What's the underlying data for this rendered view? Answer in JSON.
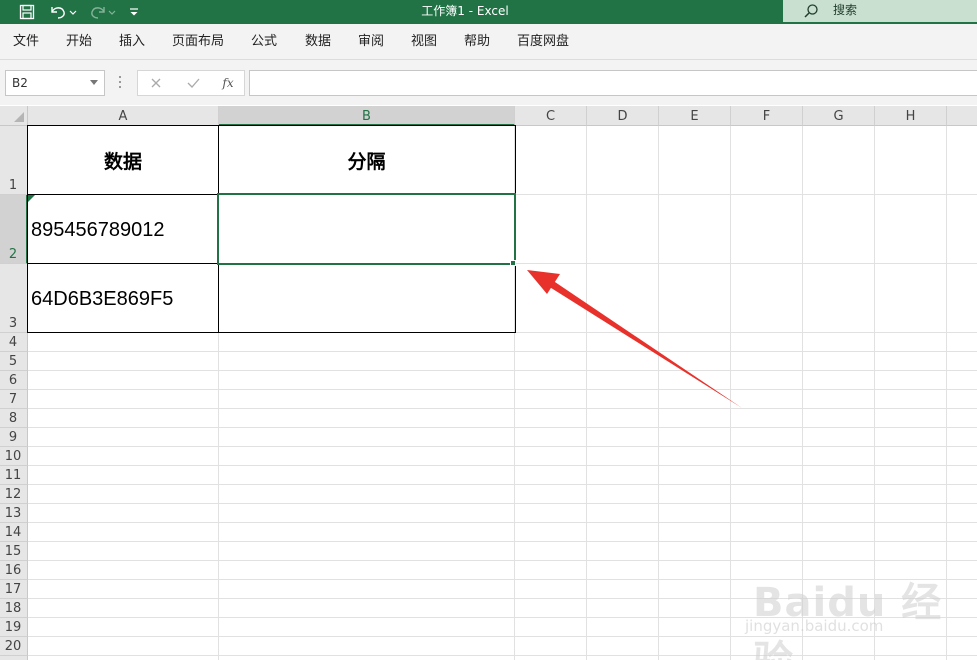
{
  "window": {
    "title": "工作簿1  -  Excel"
  },
  "search": {
    "label": "搜索"
  },
  "menu": [
    "文件",
    "开始",
    "插入",
    "页面布局",
    "公式",
    "数据",
    "审阅",
    "视图",
    "帮助",
    "百度网盘"
  ],
  "namebox": {
    "value": "B2"
  },
  "formula": {
    "fx_label": "fx",
    "value": ""
  },
  "columns": [
    "A",
    "B",
    "C",
    "D",
    "E",
    "F",
    "G",
    "H"
  ],
  "selected_column": "B",
  "rows": [
    "1",
    "2",
    "3",
    "4",
    "5",
    "6",
    "7",
    "8",
    "9",
    "10",
    "11",
    "12",
    "13",
    "14",
    "15",
    "16",
    "17",
    "18",
    "19",
    "20"
  ],
  "selected_row": "2",
  "cells": {
    "A1": "数据",
    "B1": "分隔",
    "A2": "895456789012",
    "B2": "",
    "A3": "64D6B3E869F5",
    "B3": ""
  },
  "watermark": {
    "big": "Baidu 经验",
    "small": "jingyan.baidu.com"
  },
  "colors": {
    "excel_green": "#217346",
    "arrow": "#e8312a"
  }
}
